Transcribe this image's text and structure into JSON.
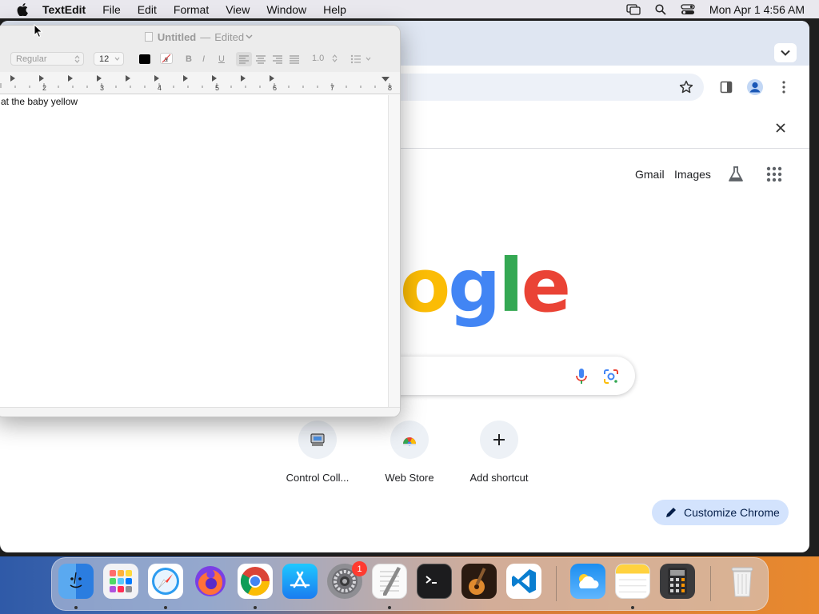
{
  "menubar": {
    "app_name": "TextEdit",
    "items": [
      "File",
      "Edit",
      "Format",
      "View",
      "Window",
      "Help"
    ],
    "clock": "Mon Apr 1  4:56 AM",
    "icons": [
      "apple-icon",
      "screen-mirroring-icon",
      "spotlight-search-icon",
      "control-center-icon"
    ]
  },
  "textedit": {
    "title": "Untitled",
    "separator": "—",
    "status": "Edited",
    "font_style": "Regular",
    "font_size": "12",
    "line_spacing": "1.0",
    "bold": "B",
    "italic": "I",
    "underline": "U",
    "ruler_numbers": [
      "2",
      "3",
      "4",
      "5",
      "6",
      "7",
      "8"
    ],
    "document_text": "at the baby yellow"
  },
  "chrome": {
    "header_links": {
      "gmail": "Gmail",
      "images": "Images"
    },
    "logo_text": "ogle",
    "logo_colors": {
      "o": "#fbbc05",
      "g": "#4285f4",
      "l": "#34a853",
      "e": "#ea4335"
    },
    "shortcuts": [
      {
        "label": "Control Coll...",
        "icon": "control-collection-icon"
      },
      {
        "label": "Web Store",
        "icon": "web-store-icon"
      },
      {
        "label": "Add shortcut",
        "icon": "plus-icon"
      }
    ],
    "customize_label": "Customize Chrome"
  },
  "dock": {
    "apps": [
      "Finder",
      "Launchpad",
      "Safari",
      "Firefox",
      "Google Chrome",
      "App Store",
      "System Settings",
      "TextEdit",
      "Terminal",
      "GarageBand",
      "Visual Studio Code",
      "Weather",
      "Notes",
      "Calculator",
      "Trash"
    ],
    "settings_badge": "1"
  }
}
